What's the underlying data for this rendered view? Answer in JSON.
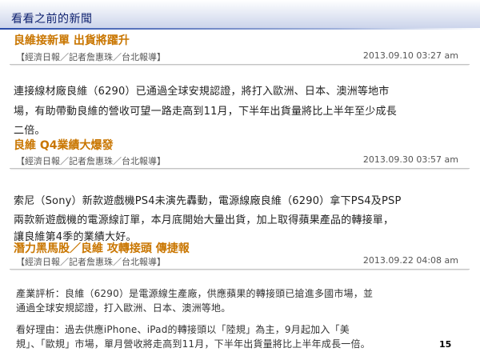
{
  "banner": {
    "title": "看看之前的新聞"
  },
  "articles": [
    {
      "headline": "良維接新單 出貨將躍升",
      "byline": "【經濟日報／記者詹惠珠／台北報導】",
      "timestamp": "2013.09.10 03:27 am",
      "lines": [
        "連接線材廠良維（6290）已通過全球安規認證，將打入歐洲、日本、澳洲等地市",
        "場，有助帶動良維的營收可望一路走高到11月，下半年出貨量將比上半年至少成長",
        "二倍。"
      ]
    },
    {
      "headline": "良維 Q4業績大爆發",
      "byline": "【經濟日報／記者詹惠珠／台北報導】",
      "timestamp": "2013.09.30 03:57 am",
      "lines": [
        "索尼（Sony）新款遊戲機PS4未演先轟動，電源線廠良維（6290）拿下PS4及PSP",
        "兩款新遊戲機的電源線訂單，本月底開始大量出貨，加上取得蘋果產品的轉接單，",
        "讓良維第4季的業績大好。"
      ]
    },
    {
      "headline": "潛力黑馬股／良維 攻轉接頭 傳捷報",
      "byline": "【經濟日報／記者詹惠珠／台北報導】",
      "timestamp": "2013.09.22 04:08 am",
      "lines": [
        "產業評析：良維（6290）是電源線生產廠，供應蘋果的轉接頭已搶進多國市場，並",
        "通過全球安規認證，打入歐洲、日本、澳洲等地。",
        "看好理由：過去供應iPhone、iPad的轉接頭以「陸規」為主，9月起加入「美",
        "規」、「歐規」市場，單月營收將走高到11月，下半年出貨量將比上半年成長一倍。"
      ]
    }
  ],
  "page_number": "15"
}
